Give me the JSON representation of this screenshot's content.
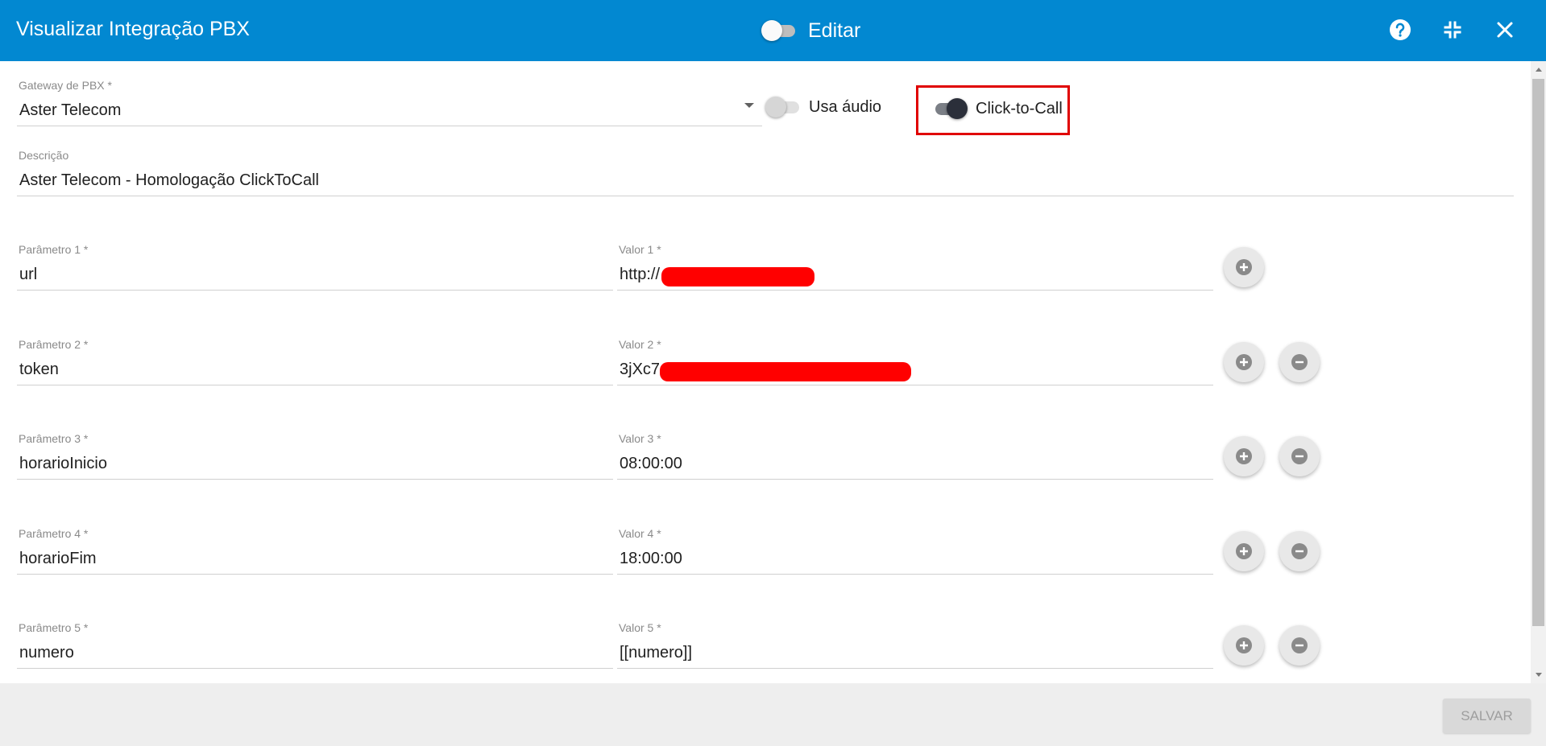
{
  "header": {
    "title": "Visualizar Integração PBX",
    "edit_label": "Editar"
  },
  "gateway": {
    "label": "Gateway de PBX *",
    "value": "Aster Telecom"
  },
  "toggles": {
    "audio_label": "Usa áudio",
    "click_to_call_label": "Click-to-Call"
  },
  "description": {
    "label": "Descrição",
    "value": "Aster Telecom - Homologação ClickToCall"
  },
  "params": [
    {
      "param_label": "Parâmetro 1 *",
      "param_value": "url",
      "value_label": "Valor 1 *",
      "value": "http://"
    },
    {
      "param_label": "Parâmetro 2 *",
      "param_value": "token",
      "value_label": "Valor 2 *",
      "value": "3jXc7"
    },
    {
      "param_label": "Parâmetro 3 *",
      "param_value": "horarioInicio",
      "value_label": "Valor 3 *",
      "value": "08:00:00"
    },
    {
      "param_label": "Parâmetro 4 *",
      "param_value": "horarioFim",
      "value_label": "Valor 4 *",
      "value": "18:00:00"
    },
    {
      "param_label": "Parâmetro 5 *",
      "param_value": "numero",
      "value_label": "Valor 5 *",
      "value": "[[numero]]"
    }
  ],
  "footer": {
    "save_label": "SALVAR"
  },
  "colors": {
    "header_bg": "#0288d1",
    "highlight_border": "#e00000",
    "redaction": "#ff0000"
  }
}
